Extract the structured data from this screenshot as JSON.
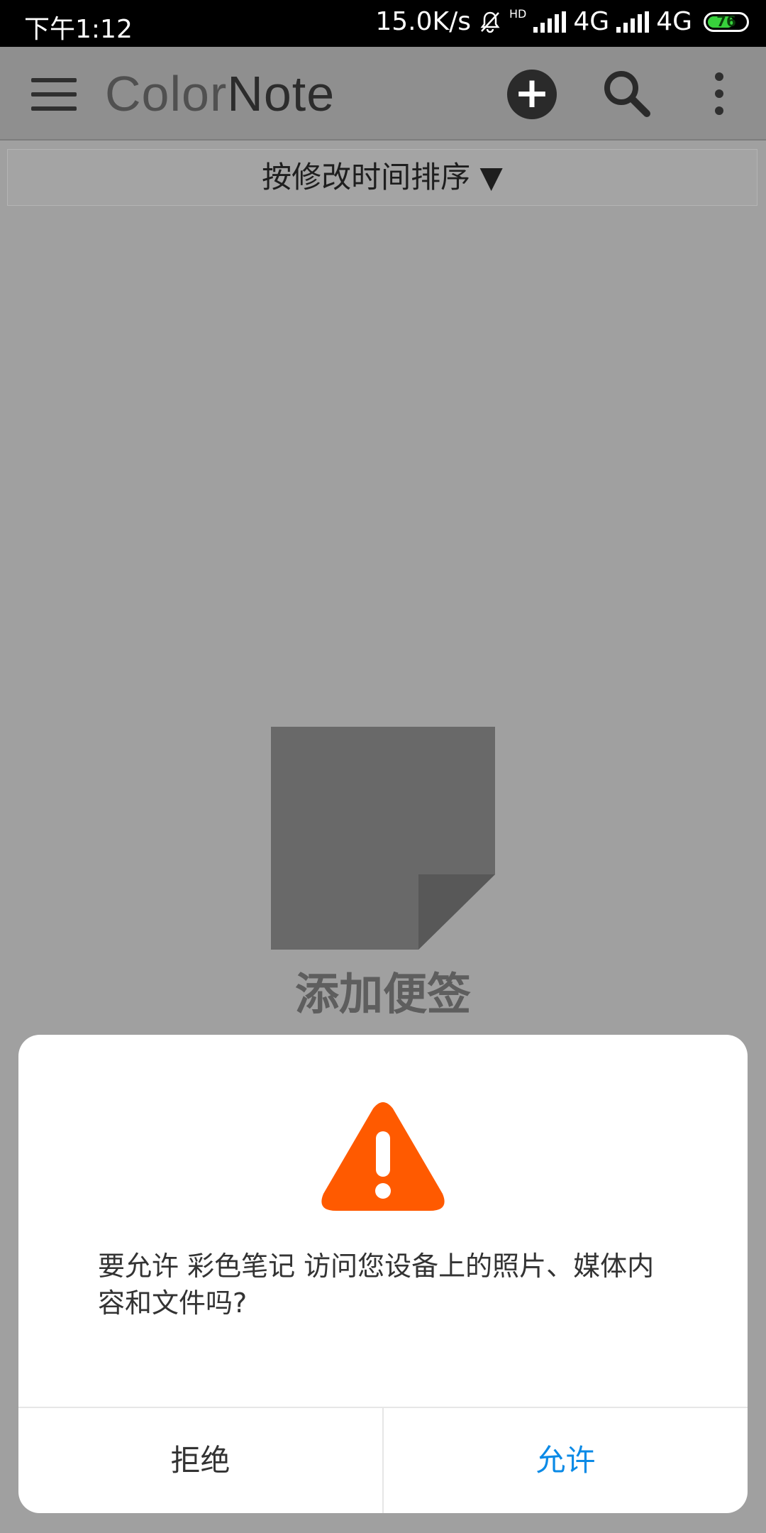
{
  "status_bar": {
    "time": "下午1:12",
    "net_speed": "15.0K/s",
    "network1": "4G",
    "network2": "4G",
    "hd_label": "HD",
    "battery_level": "76"
  },
  "app_bar": {
    "logo_part1": "Color",
    "logo_part2": "Note",
    "icons": [
      "menu-icon",
      "add-icon",
      "search-icon",
      "more-vert-icon"
    ]
  },
  "sort": {
    "label": "按修改时间排序 ▼"
  },
  "empty_state": {
    "label": "添加便签"
  },
  "dialog": {
    "message": "要允许 彩色笔记 访问您设备上的照片、媒体内容和文件吗?",
    "deny_label": "拒绝",
    "allow_label": "允许",
    "accent_color": "#0b8ae6",
    "warning_color": "#ff5a00"
  }
}
